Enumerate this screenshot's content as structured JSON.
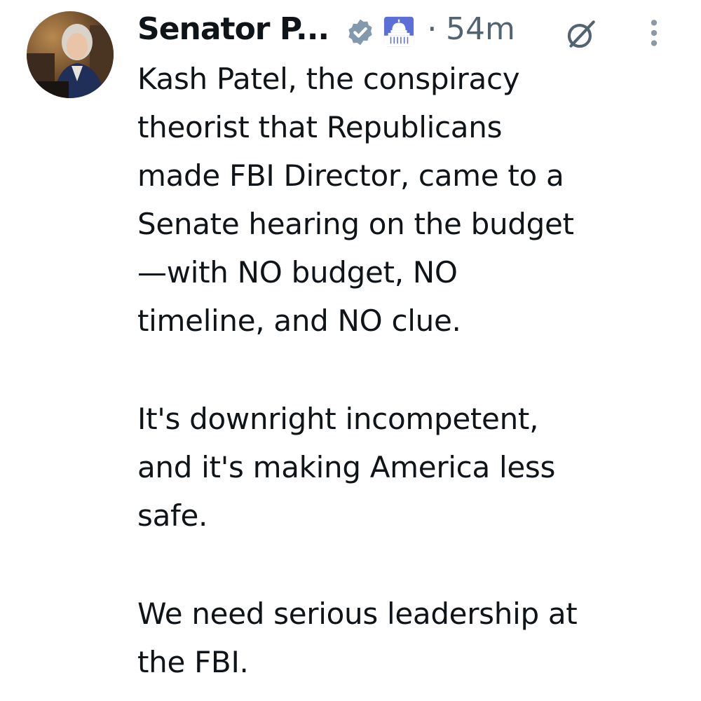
{
  "post": {
    "author": {
      "display_name": "Senator P...",
      "avatar_icon": "avatar-photo",
      "verified_icon": "verified-badge-icon",
      "affiliation_icon": "capitol-building-icon"
    },
    "separator": "·",
    "timestamp": "54m",
    "actions": {
      "grok_icon": "grok-icon",
      "more_icon": "more-vertical-icon"
    },
    "paragraphs": [
      "Kash Patel, the conspiracy\ntheorist that Republicans\nmade FBI Director, came to a\nSenate hearing on the budget\n—with NO budget, NO\ntimeline, and NO clue.",
      "It's downright incompetent,\nand it's making America less\nsafe.",
      "We need serious leadership at\nthe FBI."
    ]
  },
  "colors": {
    "text_primary": "#0f1419",
    "text_secondary": "#536471",
    "verified_badge": "#829aab",
    "affiliation_bg": "#5b6fd6"
  }
}
